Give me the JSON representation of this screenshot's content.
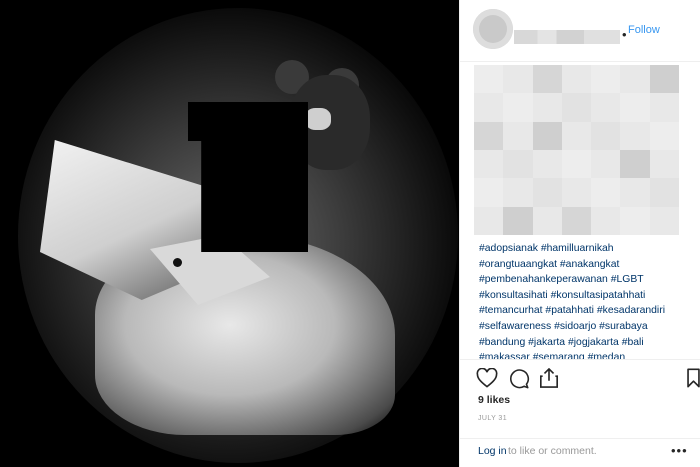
{
  "post": {
    "follow_label": "Follow",
    "separator": "•"
  },
  "caption": {
    "hashtag_lines": [
      "#adopsianak #hamilluarnikah",
      "#orangtuaangkat #anakangkat",
      "#pembenahankeperawanan #LGBT",
      "#konsultasihati #konsultasipatahhati",
      "#temancurhat #patahhati #kesadarandiri",
      "#selfawareness #sidoarjo #surabaya",
      "#bandung #jakarta #jogjakarta #bali",
      "#makassar #semarang #medan"
    ]
  },
  "stats": {
    "likes": "9 likes",
    "date": "JULY 31"
  },
  "comment_bar": {
    "login": "Log in",
    "rest": "to like or comment.",
    "more": "•••"
  },
  "icons": [
    "heart-icon",
    "comment-icon",
    "share-icon",
    "save-icon",
    "more-icon"
  ],
  "colors": {
    "link": "#003569",
    "follow": "#3897f0",
    "muted": "#999999"
  }
}
